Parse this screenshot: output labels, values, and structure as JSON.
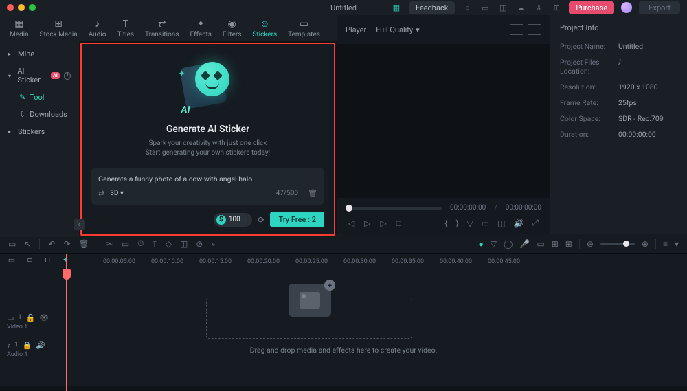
{
  "titlebar": {
    "title": "Untitled",
    "feedback": "Feedback",
    "purchase": "Purchase",
    "export": "Export"
  },
  "top_tabs": [
    {
      "icon": "▦",
      "label": "Media"
    },
    {
      "icon": "⊞",
      "label": "Stock Media"
    },
    {
      "icon": "♪",
      "label": "Audio"
    },
    {
      "icon": "T",
      "label": "Titles"
    },
    {
      "icon": "⇄",
      "label": "Transitions"
    },
    {
      "icon": "✦",
      "label": "Effects"
    },
    {
      "icon": "◉",
      "label": "Filters"
    },
    {
      "icon": "☺",
      "label": "Stickers"
    },
    {
      "icon": "▭",
      "label": "Templates"
    }
  ],
  "sidebar": {
    "mine": "Mine",
    "ai_sticker": "AI Sticker",
    "ai_badge": "AI",
    "tool": "Tool",
    "downloads": "Downloads",
    "stickers": "Stickers"
  },
  "ai_panel": {
    "title": "Generate AI Sticker",
    "sub1": "Spark your creativity with just one click",
    "sub2": "Start generating your own stickers today!",
    "prompt": "Generate a funny photo of a cow with angel halo",
    "style": "3D ▾",
    "char_count": "47/500",
    "credits": "100",
    "plus": "+",
    "try_btn": "Try Free : 2"
  },
  "player": {
    "label": "Player",
    "quality": "Full Quality",
    "tc_current": "00:00:00:00",
    "tc_total": "00:00:00:00"
  },
  "project": {
    "header": "Project Info",
    "name_label": "Project Name:",
    "name_val": "Untitled",
    "files_label": "Project Files Location:",
    "files_val": "/",
    "res_label": "Resolution:",
    "res_val": "1920 x 1080",
    "fps_label": "Frame Rate:",
    "fps_val": "25fps",
    "cs_label": "Color Space:",
    "cs_val": "SDR - Rec.709",
    "dur_label": "Duration:",
    "dur_val": "00:00:00:00"
  },
  "ruler": [
    "00:00:05:00",
    "00:00:10:00",
    "00:00:15:00",
    "00:00:20:00",
    "00:00:25:00",
    "00:00:30:00",
    "00:00:35:00",
    "00:00:40:00",
    "00:00:45:00"
  ],
  "tracks": {
    "video_count": "1",
    "video_label": "Video 1",
    "audio_count": "1",
    "audio_label": "Audio 1"
  },
  "drop_hint": "Drag and drop media and effects here to create your video."
}
